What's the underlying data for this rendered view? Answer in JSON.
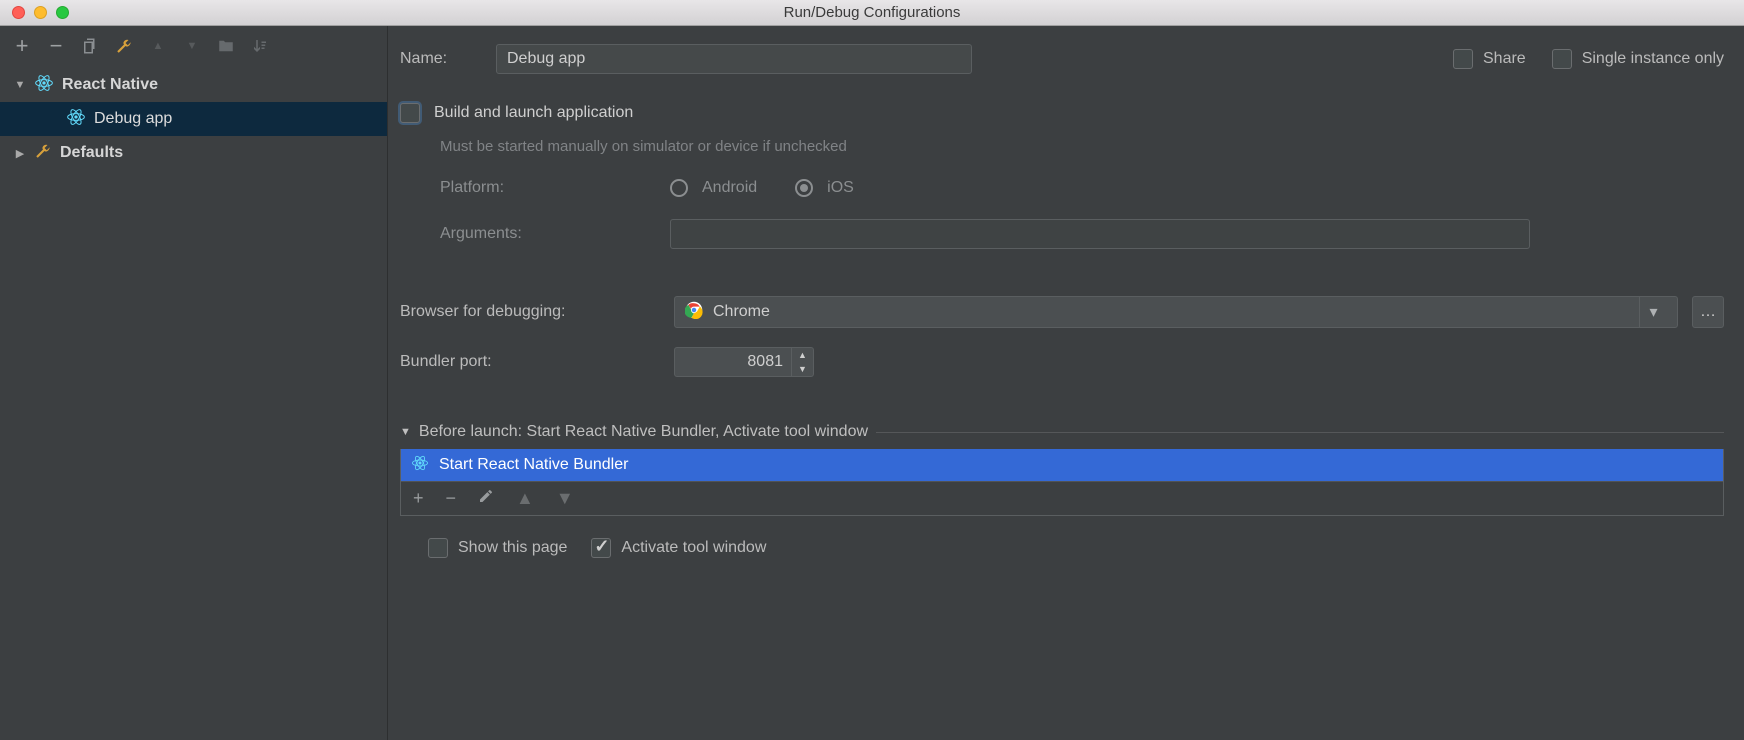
{
  "window": {
    "title": "Run/Debug Configurations"
  },
  "sidebar": {
    "categories": [
      {
        "label": "React Native",
        "expanded": true,
        "icon": "react-icon",
        "children": [
          {
            "label": "Debug app",
            "selected": true,
            "icon": "react-icon"
          }
        ]
      },
      {
        "label": "Defaults",
        "expanded": false,
        "icon": "wrench-icon",
        "children": []
      }
    ]
  },
  "form": {
    "name_label": "Name:",
    "name_value": "Debug app",
    "share_label": "Share",
    "single_instance_label": "Single instance only",
    "build_launch": {
      "label": "Build and launch application",
      "hint": "Must be started manually on simulator or device if unchecked",
      "checked": false
    },
    "platform_label": "Platform:",
    "platform_options": {
      "android": "Android",
      "ios": "iOS",
      "selected": "ios"
    },
    "arguments_label": "Arguments:",
    "arguments_value": "",
    "browser_label": "Browser for debugging:",
    "browser_value": "Chrome",
    "bundler_port_label": "Bundler port:",
    "bundler_port_value": "8081",
    "before_launch": {
      "title": "Before launch: Start React Native Bundler, Activate tool window",
      "items": [
        {
          "label": "Start React Native Bundler",
          "icon": "react-icon"
        }
      ]
    },
    "show_page_label": "Show this page",
    "show_page_checked": false,
    "activate_window_label": "Activate tool window",
    "activate_window_checked": true
  }
}
